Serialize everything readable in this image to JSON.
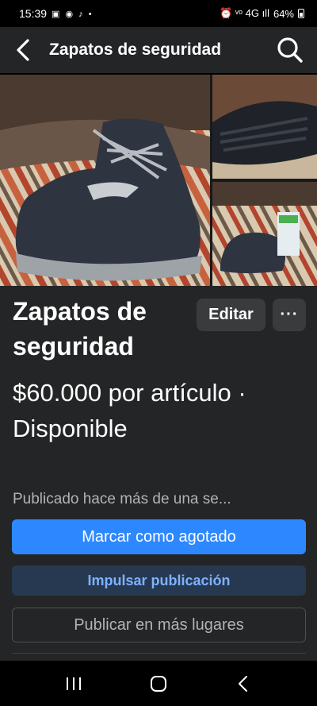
{
  "status_bar": {
    "time": "15:39",
    "left_icons": [
      "gallery-icon",
      "messenger-icon",
      "tiktok-icon",
      "dot-icon"
    ],
    "left_icons_text": "▣ ◉ ♪ •",
    "right_icons": [
      "alarm-icon",
      "volte-icon",
      "4g-icon",
      "signal-icon"
    ],
    "right_icons_text": "⏰ ᵛᵒ 4G ıll",
    "battery": "64%"
  },
  "app_bar": {
    "title": "Zapatos de seguridad"
  },
  "listing": {
    "title": "Zapatos de seguridad",
    "edit_label": "Editar",
    "more_label": "···",
    "price_line": "$60.000 por artículo · Disponible",
    "published": "Publicado hace más de una se...",
    "mark_sold_label": "Marcar como agotado",
    "boost_label": "Impulsar publicación",
    "publish_more_label": "Publicar en más lugares"
  },
  "colors": {
    "accent": "#2d88ff",
    "surface": "#242526",
    "button_secondary": "#3a3b3c",
    "boost_bg": "#263951",
    "boost_text": "#7fb2ff"
  },
  "nav_bar": {
    "icons": [
      "recent-apps-icon",
      "home-icon",
      "back-icon"
    ]
  }
}
